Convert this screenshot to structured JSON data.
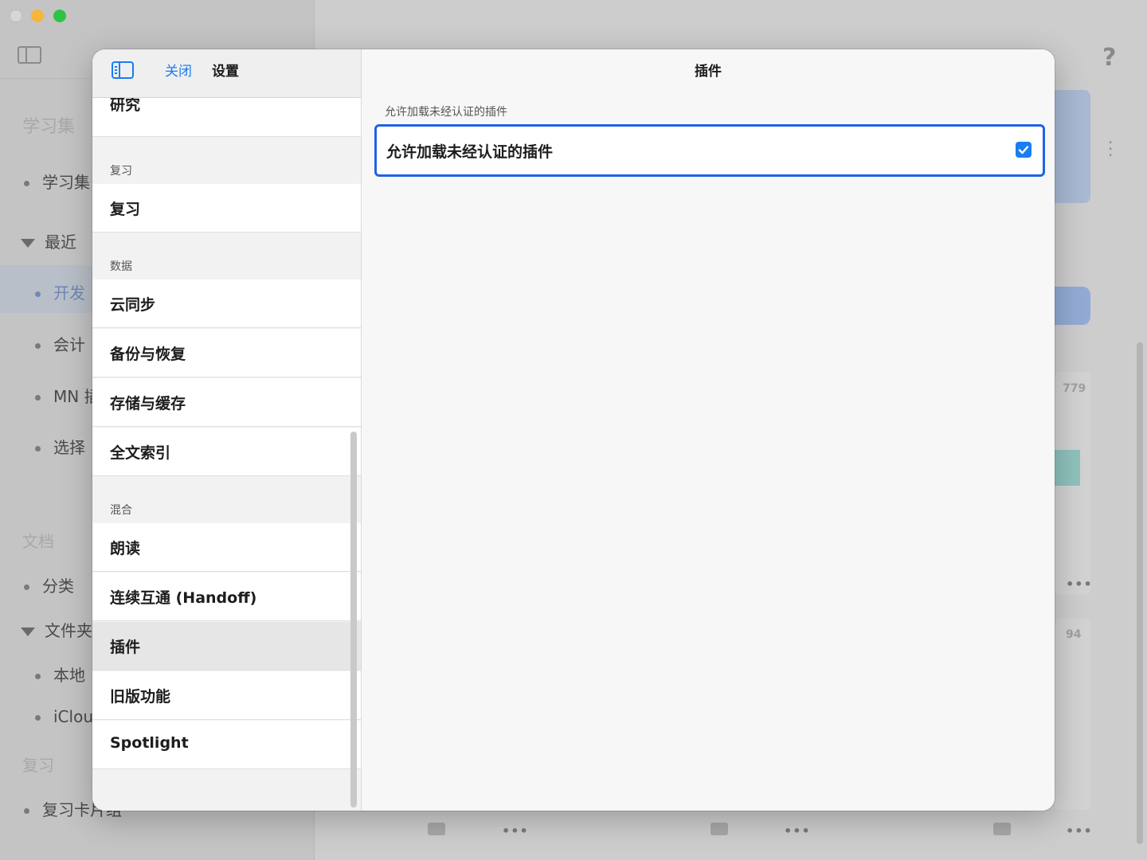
{
  "background": {
    "sections": {
      "study_sets": "学习集",
      "documents": "文档",
      "review": "复习"
    },
    "items": {
      "study_set": "学习集",
      "recent": "最近",
      "dev": "开发",
      "accounting": "会计",
      "mn": "MN 插",
      "select": "选择",
      "category": "分类",
      "folders": "文件夹",
      "local": "本地",
      "icloud": "iClou",
      "review_cards": "复习卡片组"
    },
    "counts": {
      "a": "779",
      "b": "94"
    },
    "help": "?",
    "dots": "•••"
  },
  "settings": {
    "close_label": "关闭",
    "title": "设置",
    "list": {
      "research": "研究",
      "section_review": "复习",
      "review": "复习",
      "section_data": "数据",
      "cloud_sync": "云同步",
      "backup_restore": "备份与恢复",
      "storage_cache": "存储与缓存",
      "fulltext_index": "全文索引",
      "section_misc": "混合",
      "read_aloud": "朗读",
      "handoff": "连续互通 (Handoff)",
      "plugins": "插件",
      "legacy": "旧版功能",
      "spotlight": "Spotlight"
    }
  },
  "detail": {
    "title": "插件",
    "section_header": "允许加载未经认证的插件",
    "option_label": "允许加载未经认证的插件",
    "option_checked": true,
    "accent_color": "#1a7cf5"
  }
}
